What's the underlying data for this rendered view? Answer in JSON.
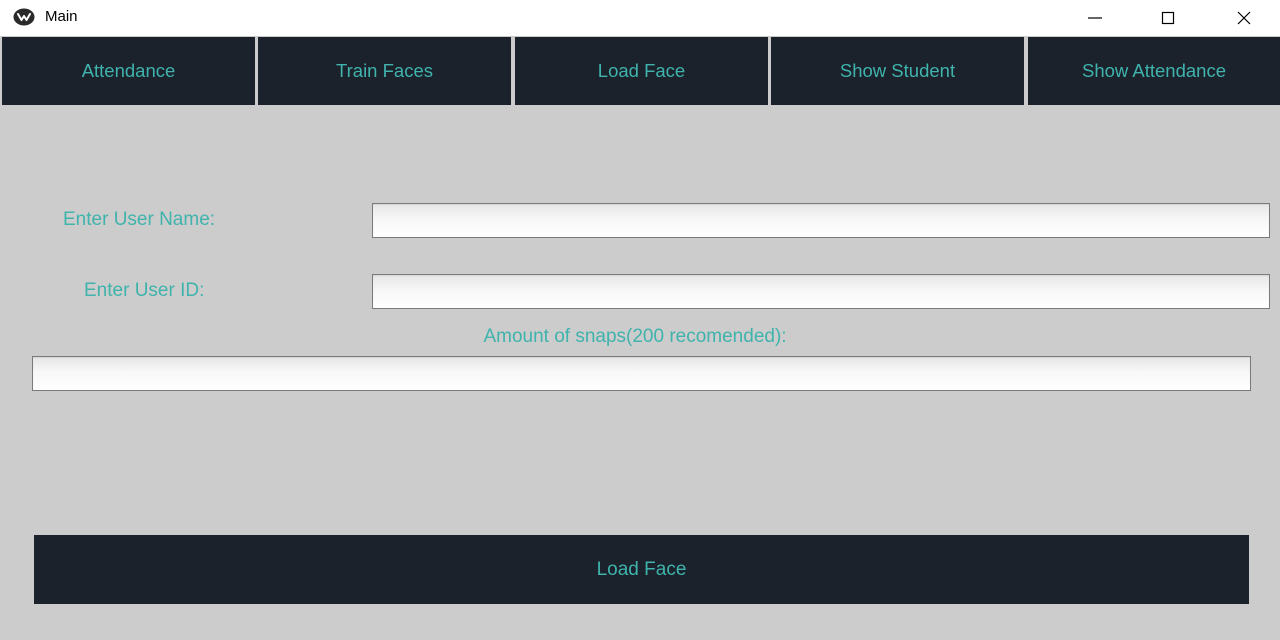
{
  "window": {
    "title": "Main",
    "icon": "kivy-logo-icon"
  },
  "nav": {
    "items": [
      {
        "label": "Attendance"
      },
      {
        "label": "Train Faces"
      },
      {
        "label": "Load Face"
      },
      {
        "label": "Show Student"
      },
      {
        "label": "Show Attendance"
      }
    ]
  },
  "form": {
    "user_name_label": "Enter User Name:",
    "user_name_value": "",
    "user_id_label": "Enter User ID:",
    "user_id_value": "",
    "snaps_label": "Amount of snaps(200 recomended):",
    "snaps_value": "",
    "submit_label": "Load Face"
  },
  "colors": {
    "button_bg": "#1b222c",
    "accent_text": "#3fb3ac",
    "background": "#cccccc",
    "titlebar": "#ffffff"
  }
}
